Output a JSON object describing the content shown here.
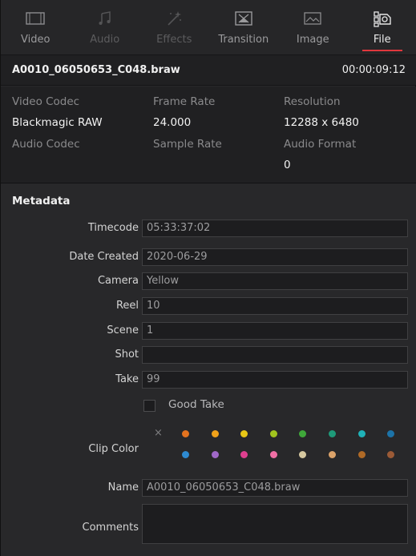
{
  "tabs": [
    {
      "label": "Video",
      "icon": "video-icon",
      "state": "normal"
    },
    {
      "label": "Audio",
      "icon": "audio-icon",
      "state": "disabled"
    },
    {
      "label": "Effects",
      "icon": "effects-icon",
      "state": "disabled"
    },
    {
      "label": "Transition",
      "icon": "transition-icon",
      "state": "normal"
    },
    {
      "label": "Image",
      "icon": "image-icon",
      "state": "normal"
    },
    {
      "label": "File",
      "icon": "file-icon",
      "state": "active"
    }
  ],
  "clip": {
    "name": "A0010_06050653_C048.braw",
    "duration": "00:00:09:12"
  },
  "info": {
    "video_codec_label": "Video Codec",
    "video_codec": "Blackmagic RAW",
    "frame_rate_label": "Frame Rate",
    "frame_rate": "24.000",
    "resolution_label": "Resolution",
    "resolution": "12288 x 6480",
    "audio_codec_label": "Audio Codec",
    "sample_rate_label": "Sample Rate",
    "audio_format_label": "Audio Format",
    "audio_format": "0"
  },
  "metadata": {
    "title": "Metadata",
    "timecode_label": "Timecode",
    "timecode": "05:33:37:02",
    "date_label": "Date Created",
    "date": "2020-06-29",
    "camera_label": "Camera",
    "camera": "Yellow",
    "reel_label": "Reel",
    "reel": "10",
    "scene_label": "Scene",
    "scene": "1",
    "shot_label": "Shot",
    "shot": "",
    "take_label": "Take",
    "take": "99",
    "good_take_label": "Good Take",
    "clip_color_label": "Clip Color",
    "clip_color_none": "×",
    "clip_colors": [
      "#e3731f",
      "#f0a21a",
      "#e8c716",
      "#a1c41e",
      "#3fa83a",
      "#1e9a79",
      "#1fb2b8",
      "#1c73a8",
      "#2e8ad0",
      "#a068c8",
      "#de3f8f",
      "#f06fa5",
      "#d6c8a0",
      "#dba36a",
      "#b06a26",
      "#9b5a36"
    ],
    "name_label": "Name",
    "name": "A0010_06050653_C048.braw",
    "comments_label": "Comments",
    "comments": ""
  }
}
